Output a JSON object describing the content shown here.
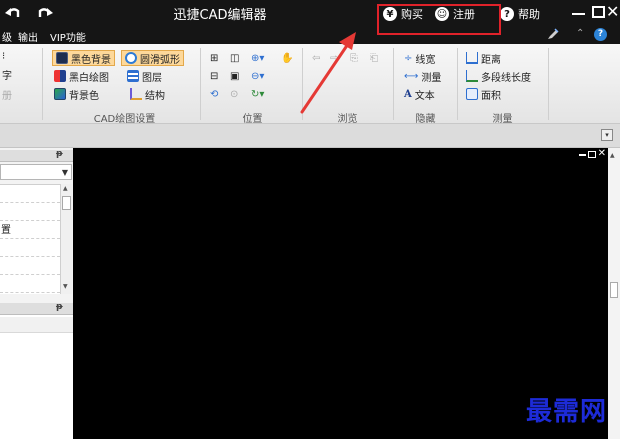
{
  "titlebar": {
    "app_title": "迅捷CAD编辑器",
    "buy": {
      "icon_char": "¥",
      "label": "购买"
    },
    "register": {
      "icon_char": "☺",
      "label": "注册"
    },
    "help": {
      "icon_char": "?",
      "label": "帮助"
    }
  },
  "menubar": {
    "items": [
      {
        "label": "级"
      },
      {
        "label": "输出"
      },
      {
        "label": "VIP功能"
      }
    ],
    "help_char": "?"
  },
  "ribbon": {
    "left_partial": [
      "字",
      "册"
    ],
    "cad_settings": {
      "items": [
        "黑色背景",
        "圆滑弧形",
        "黑白绘图",
        "图层",
        "背景色",
        "结构"
      ],
      "group_label": "CAD绘图设置"
    },
    "position": {
      "group_label": "位置"
    },
    "browse": {
      "group_label": "浏览"
    },
    "hide": {
      "items": [
        "线宽",
        "测量",
        "文本"
      ],
      "group_label": "隐藏"
    },
    "measure": {
      "items": [
        "距离",
        "多段线长度",
        "面积"
      ],
      "group_label": "测量"
    }
  },
  "leftpanel": {
    "pin_char": "ᵽ",
    "list_rows": [
      "",
      "",
      "置",
      "",
      "",
      ""
    ]
  },
  "watermark": "最需网",
  "colors": {
    "titlebar_bg": "#151515",
    "canvas_bg": "#000000",
    "highlight_border": "#e0222a",
    "arrow": "#e53935",
    "watermark": "#1d2bd8"
  }
}
